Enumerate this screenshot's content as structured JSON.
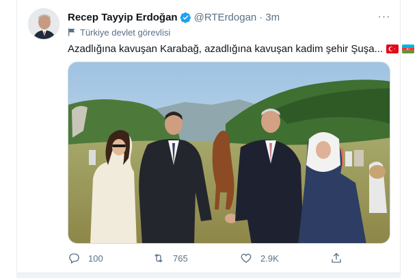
{
  "tweet": {
    "author_name": "Recep Tayyip Erdoğan",
    "handle": "@RTErdogan",
    "separator": "·",
    "time": "3m",
    "label": "Türkiye devlet görevlisi",
    "text": "Azadlığına kavuşan Karabağ, azadlığına kavuşan kadim şehir Şuşa...",
    "flag_emojis": [
      "turkey-flag",
      "azerbaijan-flag"
    ],
    "more_label": "···"
  },
  "actions": {
    "reply_count": "100",
    "retweet_count": "765",
    "like_count": "2.9K"
  },
  "colors": {
    "verified": "#1da1f2",
    "muted_text": "#5b7083",
    "text": "#0f1419",
    "border": "#e6ecf0"
  }
}
